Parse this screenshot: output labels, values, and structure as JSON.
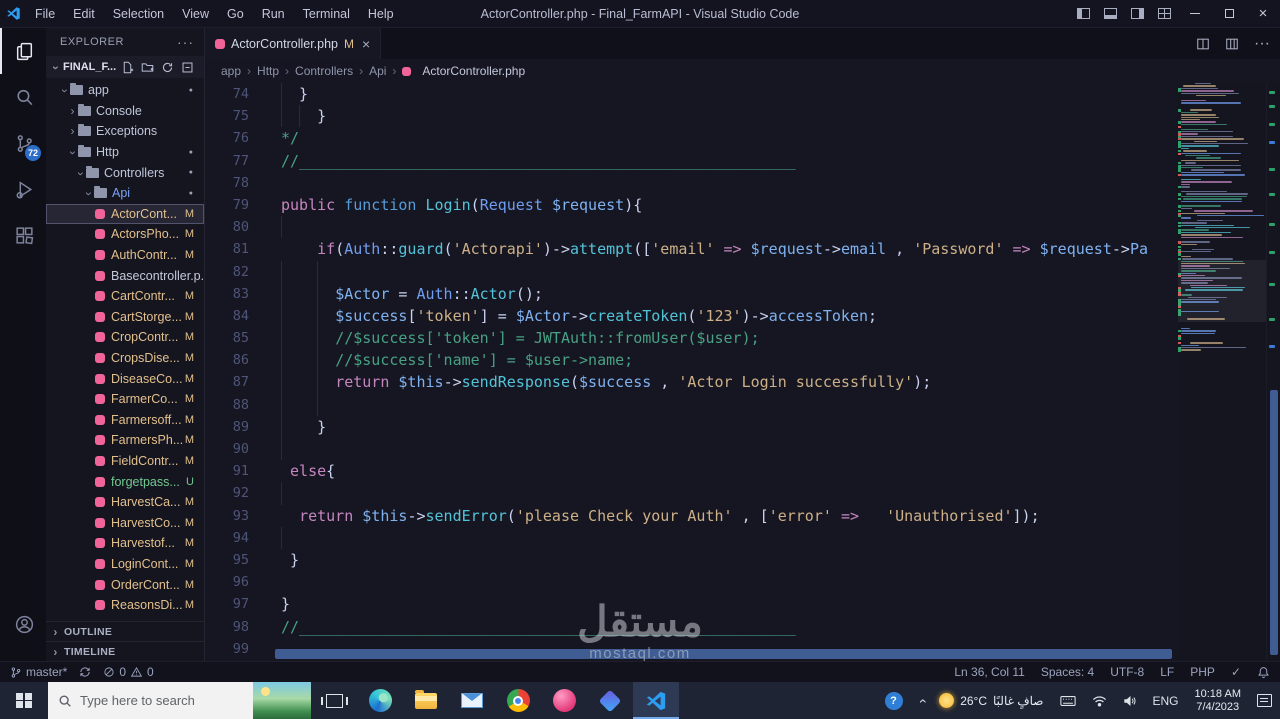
{
  "title_bar": {
    "menus": [
      "File",
      "Edit",
      "Selection",
      "View",
      "Go",
      "Run",
      "Terminal",
      "Help"
    ],
    "title": "ActorController.php - Final_FarmAPI - Visual Studio Code"
  },
  "activity_bar": {
    "badge": "72"
  },
  "explorer": {
    "header": "EXPLORER",
    "root": "FINAL_F...",
    "sections": [
      "OUTLINE",
      "TIMELINE"
    ],
    "items": [
      {
        "label": "app",
        "type": "folder",
        "level": 1,
        "expanded": true,
        "dot": true
      },
      {
        "label": "Console",
        "type": "folder",
        "level": 2,
        "expanded": false
      },
      {
        "label": "Exceptions",
        "type": "folder",
        "level": 2,
        "expanded": false
      },
      {
        "label": "Http",
        "type": "folder",
        "level": 2,
        "expanded": true,
        "dot": true
      },
      {
        "label": "Controllers",
        "type": "folder",
        "level": 3,
        "expanded": true,
        "dot": true
      },
      {
        "label": "Api",
        "type": "folder",
        "level": 4,
        "expanded": true,
        "dot": true,
        "accent": true
      },
      {
        "label": "ActorCont...",
        "type": "file",
        "level": 5,
        "badge": "M",
        "state": "modified",
        "selected": true
      },
      {
        "label": "ActorsPho...",
        "type": "file",
        "level": 5,
        "badge": "M",
        "state": "modified"
      },
      {
        "label": "AuthContr...",
        "type": "file",
        "level": 5,
        "badge": "M",
        "state": "modified"
      },
      {
        "label": "Basecontroller.p...",
        "type": "file",
        "level": 5,
        "badge": "",
        "state": "normal"
      },
      {
        "label": "CartContr...",
        "type": "file",
        "level": 5,
        "badge": "M",
        "state": "modified"
      },
      {
        "label": "CartStorge...",
        "type": "file",
        "level": 5,
        "badge": "M",
        "state": "modified"
      },
      {
        "label": "CropContr...",
        "type": "file",
        "level": 5,
        "badge": "M",
        "state": "modified"
      },
      {
        "label": "CropsDise...",
        "type": "file",
        "level": 5,
        "badge": "M",
        "state": "modified"
      },
      {
        "label": "DiseaseCo...",
        "type": "file",
        "level": 5,
        "badge": "M",
        "state": "modified"
      },
      {
        "label": "FarmerCo...",
        "type": "file",
        "level": 5,
        "badge": "M",
        "state": "modified"
      },
      {
        "label": "Farmersoff...",
        "type": "file",
        "level": 5,
        "badge": "M",
        "state": "modified"
      },
      {
        "label": "FarmersPh...",
        "type": "file",
        "level": 5,
        "badge": "M",
        "state": "modified"
      },
      {
        "label": "FieldContr...",
        "type": "file",
        "level": 5,
        "badge": "M",
        "state": "modified"
      },
      {
        "label": "forgetpass...",
        "type": "file",
        "level": 5,
        "badge": "U",
        "state": "untracked"
      },
      {
        "label": "HarvestCa...",
        "type": "file",
        "level": 5,
        "badge": "M",
        "state": "modified"
      },
      {
        "label": "HarvestCo...",
        "type": "file",
        "level": 5,
        "badge": "M",
        "state": "modified"
      },
      {
        "label": "Harvestof...",
        "type": "file",
        "level": 5,
        "badge": "M",
        "state": "modified"
      },
      {
        "label": "LoginCont...",
        "type": "file",
        "level": 5,
        "badge": "M",
        "state": "modified"
      },
      {
        "label": "OrderCont...",
        "type": "file",
        "level": 5,
        "badge": "M",
        "state": "modified"
      },
      {
        "label": "ReasonsDi...",
        "type": "file",
        "level": 5,
        "badge": "M",
        "state": "modified"
      }
    ]
  },
  "tab": {
    "label": "ActorController.php",
    "badge": "M",
    "close": "×"
  },
  "breadcrumbs": [
    "app",
    "Http",
    "Controllers",
    "Api",
    "ActorController.php"
  ],
  "editor": {
    "lines": [
      {
        "n": "74",
        "g": [
          0
        ],
        "seg": [
          [
            "p",
            "  }"
          ]
        ]
      },
      {
        "n": "75",
        "g": [
          0,
          2
        ],
        "seg": [
          [
            "p",
            "    }"
          ]
        ]
      },
      {
        "n": "76",
        "seg": [
          [
            "cm",
            "*/"
          ]
        ]
      },
      {
        "n": "77",
        "seg": [
          [
            "cm",
            "//_______________________________________________________"
          ]
        ]
      },
      {
        "n": "78",
        "seg": []
      },
      {
        "n": "79",
        "seg": [
          [
            "kw",
            "public"
          ],
          [
            "p",
            " "
          ],
          [
            "kwb",
            "function"
          ],
          [
            "p",
            " "
          ],
          [
            "fn",
            "Login"
          ],
          [
            "p",
            "("
          ],
          [
            "cls",
            "Request"
          ],
          [
            "p",
            " "
          ],
          [
            "v",
            "$request"
          ],
          [
            "p",
            "){"
          ]
        ]
      },
      {
        "n": "80",
        "g": [
          0
        ],
        "seg": []
      },
      {
        "n": "81",
        "seg": [
          [
            "p",
            "    "
          ],
          [
            "kw",
            "if"
          ],
          [
            "p",
            "("
          ],
          [
            "cls",
            "Auth"
          ],
          [
            "p",
            "::"
          ],
          [
            "fn",
            "guard"
          ],
          [
            "p",
            "("
          ],
          [
            "s",
            "'Actorapi'"
          ],
          [
            "p",
            ")->"
          ],
          [
            "fn",
            "attempt"
          ],
          [
            "p",
            "(["
          ],
          [
            "s",
            "'email'"
          ],
          [
            "p",
            " "
          ],
          [
            "op",
            "=>"
          ],
          [
            "p",
            " "
          ],
          [
            "v",
            "$request"
          ],
          [
            "p",
            "->"
          ],
          [
            "v",
            "email"
          ],
          [
            "p",
            " , "
          ],
          [
            "s",
            "'Password'"
          ],
          [
            "p",
            " "
          ],
          [
            "op",
            "=>"
          ],
          [
            "p",
            " "
          ],
          [
            "v",
            "$request"
          ],
          [
            "p",
            "->"
          ],
          [
            "v",
            "Pa"
          ]
        ]
      },
      {
        "n": "82",
        "g": [
          0,
          4
        ],
        "seg": []
      },
      {
        "n": "83",
        "g": [
          0,
          4
        ],
        "seg": [
          [
            "p",
            "      "
          ],
          [
            "v",
            "$Actor"
          ],
          [
            "p",
            " = "
          ],
          [
            "cls",
            "Auth"
          ],
          [
            "p",
            "::"
          ],
          [
            "fn",
            "Actor"
          ],
          [
            "p",
            "();"
          ]
        ]
      },
      {
        "n": "84",
        "g": [
          0,
          4
        ],
        "seg": [
          [
            "p",
            "      "
          ],
          [
            "v",
            "$success"
          ],
          [
            "p",
            "["
          ],
          [
            "s",
            "'token'"
          ],
          [
            "p",
            "] = "
          ],
          [
            "v",
            "$Actor"
          ],
          [
            "p",
            "->"
          ],
          [
            "fn",
            "createToken"
          ],
          [
            "p",
            "("
          ],
          [
            "s",
            "'123'"
          ],
          [
            "p",
            ")->"
          ],
          [
            "v",
            "accessToken"
          ],
          [
            "p",
            ";"
          ]
        ]
      },
      {
        "n": "85",
        "g": [
          0,
          4
        ],
        "seg": [
          [
            "p",
            "      "
          ],
          [
            "cm",
            "//$success['token'] = JWTAuth::fromUser($user);"
          ]
        ]
      },
      {
        "n": "86",
        "g": [
          0,
          4
        ],
        "seg": [
          [
            "p",
            "      "
          ],
          [
            "cm",
            "//$success['name'] = $user->name;"
          ]
        ]
      },
      {
        "n": "87",
        "g": [
          0,
          4
        ],
        "seg": [
          [
            "p",
            "      "
          ],
          [
            "kw",
            "return"
          ],
          [
            "p",
            " "
          ],
          [
            "v",
            "$this"
          ],
          [
            "p",
            "->"
          ],
          [
            "fn",
            "sendResponse"
          ],
          [
            "p",
            "("
          ],
          [
            "v",
            "$success"
          ],
          [
            "p",
            " , "
          ],
          [
            "s",
            "'Actor Login successfully'"
          ],
          [
            "p",
            ");"
          ]
        ]
      },
      {
        "n": "88",
        "g": [
          0,
          4
        ],
        "seg": []
      },
      {
        "n": "89",
        "g": [
          0
        ],
        "seg": [
          [
            "p",
            "    }"
          ]
        ]
      },
      {
        "n": "90",
        "g": [
          0
        ],
        "seg": []
      },
      {
        "n": "91",
        "seg": [
          [
            "p",
            " "
          ],
          [
            "kw",
            "else"
          ],
          [
            "p",
            "{"
          ]
        ]
      },
      {
        "n": "92",
        "g": [
          0
        ],
        "seg": []
      },
      {
        "n": "93",
        "seg": [
          [
            "p",
            "  "
          ],
          [
            "kw",
            "return"
          ],
          [
            "p",
            " "
          ],
          [
            "v",
            "$this"
          ],
          [
            "p",
            "->"
          ],
          [
            "fn",
            "sendError"
          ],
          [
            "p",
            "("
          ],
          [
            "s",
            "'please Check your Auth'"
          ],
          [
            "p",
            " , ["
          ],
          [
            "s",
            "'error'"
          ],
          [
            "p",
            " "
          ],
          [
            "op",
            "=>"
          ],
          [
            "p",
            "   "
          ],
          [
            "s",
            "'Unauthorised'"
          ],
          [
            "p",
            "]);"
          ]
        ]
      },
      {
        "n": "94",
        "g": [
          0
        ],
        "seg": []
      },
      {
        "n": "95",
        "seg": [
          [
            "p",
            " }"
          ]
        ]
      },
      {
        "n": "96",
        "seg": []
      },
      {
        "n": "97",
        "seg": [
          [
            "p",
            "}"
          ]
        ]
      },
      {
        "n": "98",
        "seg": [
          [
            "cm",
            "//_______________________________________________________"
          ]
        ]
      },
      {
        "n": "99",
        "seg": []
      }
    ]
  },
  "status_bar": {
    "branch": "master*",
    "errors": "0",
    "warnings": "0",
    "line_col": "Ln 36, Col 11",
    "indent": "Spaces: 4",
    "encoding": "UTF-8",
    "eol": "LF",
    "language": "PHP"
  },
  "taskbar": {
    "search_placeholder": "Type here to search",
    "weather_temp": "26°C",
    "weather_desc": "صافٍ غالبًا",
    "lang": "ENG",
    "time": "10:18 AM",
    "date": "7/4/2023"
  },
  "watermark": {
    "title": "مستقل",
    "domain": "mostaql.com"
  }
}
